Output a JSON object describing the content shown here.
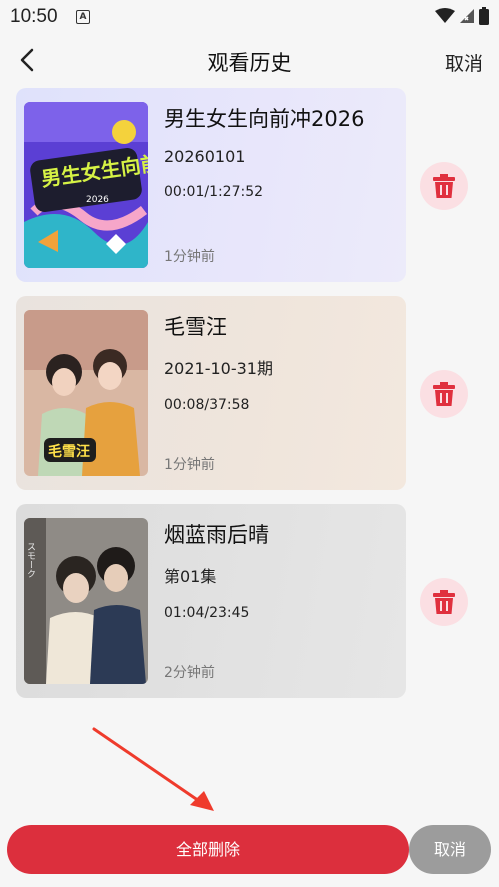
{
  "status_bar": {
    "time": "10:50",
    "notification_icon": "A"
  },
  "header": {
    "title": "观看历史",
    "cancel_label": "取消"
  },
  "history": [
    {
      "title": "男生女生向前冲2026",
      "episode": "20260101",
      "progress": "00:01/1:27:52",
      "time_ago": "1分钟前"
    },
    {
      "title": "毛雪汪",
      "episode": "2021-10-31期",
      "progress": "00:08/37:58",
      "time_ago": "1分钟前"
    },
    {
      "title": "烟蓝雨后晴",
      "episode": "第01集",
      "progress": "01:04/23:45",
      "time_ago": "2分钟前"
    }
  ],
  "poster_text": {
    "p0_logo": "男生女生向前冲",
    "p0_year": "2026",
    "p1_logo": "毛雪汪",
    "p2_side": "スモーク"
  },
  "footer": {
    "delete_all_label": "全部删除",
    "cancel_label": "取消"
  },
  "colors": {
    "delete_all": "#dc2f3d",
    "cancel": "#9c9c9c",
    "trash_icon": "#e0303e",
    "trash_bg": "#fbdfe3",
    "arrow": "#ef3b2c"
  }
}
